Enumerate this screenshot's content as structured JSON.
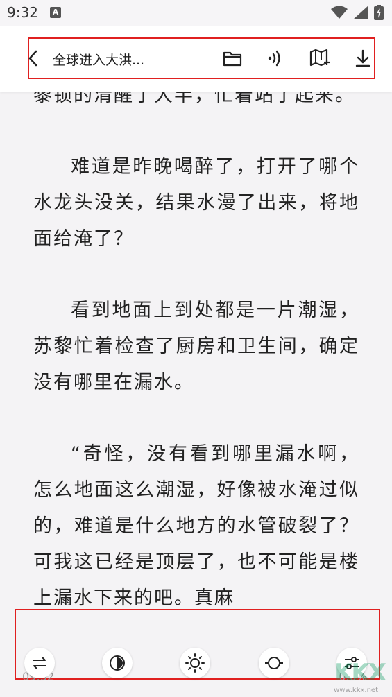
{
  "status_bar": {
    "time": "9:32",
    "notification_letter": "A",
    "icons": [
      "wifi-icon",
      "signal-icon",
      "battery-charging-icon"
    ]
  },
  "toolbar": {
    "title": "全球进入大洪...",
    "icons": [
      "back-icon",
      "folder-icon",
      "listen-icon",
      "add-bookmark-icon",
      "download-icon"
    ]
  },
  "content": {
    "paragraphs": [
      "黎锁的清醒了大半，忙着站了起来。",
      "难道是昨晚喝醉了，打开了哪个水龙头没关，结果水漫了出来，将地面给淹了？",
      "看到地面上到处都是一片潮湿，苏黎忙着检查了厨房和卫生间，确定没有哪里在漏水。",
      "“奇怪，没有看到哪里漏水啊，怎么地面这么潮湿，好像被水淹过似的，难道是什么地方的水管破裂了？可我这已经是顶层了，也不可能是楼上漏水下来的吧。真麻"
    ]
  },
  "bottom_bar": {
    "controls": [
      "swap-icon",
      "contrast-icon",
      "brightness-icon",
      "toggle-icon",
      "settings-sliders-icon"
    ]
  },
  "footer": {
    "time": "09:32",
    "progress": "0.0%"
  },
  "watermark": {
    "text": "KKX",
    "url": "www.kkx.net"
  },
  "colors": {
    "background": "#f4f3f5",
    "toolbar": "#ffffff",
    "highlight_frame": "#e02020",
    "text": "#222222"
  }
}
